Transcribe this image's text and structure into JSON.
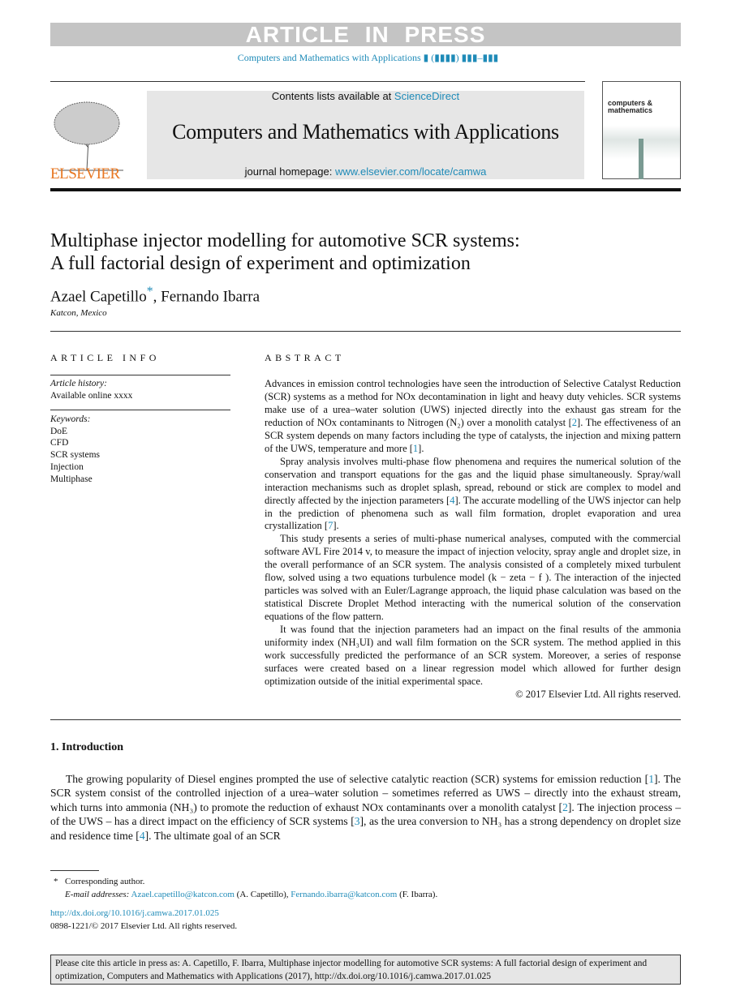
{
  "banner": "ARTICLE IN PRESS",
  "journal_ref": "Computers and Mathematics with Applications ▮ (▮▮▮▮) ▮▮▮–▮▮▮",
  "publisher": "ELSEVIER",
  "contents_prefix": "Contents lists available at ",
  "contents_link": "ScienceDirect",
  "journal_title": "Computers and Mathematics with Applications",
  "homepage_prefix": "journal homepage: ",
  "homepage_link": "www.elsevier.com/locate/camwa",
  "cover_title": "computers & mathematics",
  "title_line1": "Multiphase injector modelling for automotive SCR systems:",
  "title_line2": "A full factorial design of experiment and optimization",
  "author1": "Azael Capetillo",
  "author_star": "*",
  "author_sep": ", ",
  "author2": "Fernando Ibarra",
  "affiliation": "Katcon, Mexico",
  "article_info": {
    "heading": "ARTICLE INFO",
    "history_label": "Article history:",
    "history_value": "Available online xxxx",
    "keywords_label": "Keywords:",
    "keywords": [
      "DoE",
      "CFD",
      "SCR systems",
      "Injection",
      "Multiphase"
    ]
  },
  "abstract": {
    "heading": "ABSTRACT",
    "paragraphs": [
      [
        {
          "t": "Advances in emission control technologies have seen the introduction of Selective Catalyst Reduction (SCR) systems as a method for NOx decontamination in light and heavy duty vehicles. SCR systems make use of a urea–water solution (UWS) injected directly into the exhaust gas stream for the reduction of NOx contaminants to Nitrogen (N₂) over a monolith catalyst ["
        },
        {
          "t": "2",
          "l": 1
        },
        {
          "t": "]. The effectiveness of an SCR system depends on many factors including the type of catalysts, the injection and mixing pattern of the UWS, temperature and more ["
        },
        {
          "t": "1",
          "l": 1
        },
        {
          "t": "]."
        }
      ],
      [
        {
          "t": "Spray analysis involves multi-phase flow phenomena and requires the numerical solution of the conservation and transport equations for the gas and the liquid phase simultaneously. Spray/wall interaction mechanisms such as droplet splash, spread, rebound or stick are complex to model and directly affected by the injection parameters ["
        },
        {
          "t": "4",
          "l": 1
        },
        {
          "t": "]. The accurate modelling of the UWS injector can help in the prediction of phenomena such as wall film formation, droplet evaporation and urea crystallization ["
        },
        {
          "t": "7",
          "l": 1
        },
        {
          "t": "]."
        }
      ],
      [
        {
          "t": "This study presents a series of multi-phase numerical analyses, computed with the commercial software AVL Fire 2014 v, to measure the impact of injection velocity, spray angle and droplet size, in the overall performance of an SCR system. The analysis consisted of a completely mixed turbulent flow, solved using a two equations turbulence model (k − zeta − f ). The interaction of the injected particles was solved with an Euler/Lagrange approach, the liquid phase calculation was based on the statistical Discrete Droplet Method interacting with the numerical solution of the conservation equations of the flow pattern."
        }
      ],
      [
        {
          "t": "It was found that the injection parameters had an impact on the final results of the ammonia uniformity index (NH₃UI) and wall film formation on the SCR system. The method applied in this work successfully predicted the performance of an SCR system. Moreover, a series of response surfaces were created based on a linear regression model which allowed for further design optimization outside of the initial experimental space."
        }
      ]
    ],
    "copyright": "© 2017 Elsevier Ltd. All rights reserved."
  },
  "intro": {
    "heading": "1.  Introduction",
    "paragraph": [
      {
        "t": "The growing popularity of Diesel engines prompted the use of selective catalytic reaction (SCR) systems for emission reduction ["
      },
      {
        "t": "1",
        "l": 1
      },
      {
        "t": "]. The SCR system consist of the controlled injection of a urea–water solution – sometimes referred as UWS – directly into the exhaust stream, which turns into ammonia (NH₃) to promote the reduction of exhaust NOx contaminants over a monolith catalyst ["
      },
      {
        "t": "2",
        "l": 1
      },
      {
        "t": "]. The injection process – of the UWS – has a direct impact on the efficiency of SCR systems ["
      },
      {
        "t": "3",
        "l": 1
      },
      {
        "t": "], as the urea conversion to NH₃ has a strong dependency on droplet size and residence time ["
      },
      {
        "t": "4",
        "l": 1
      },
      {
        "t": "]. The ultimate goal of an SCR"
      }
    ]
  },
  "footnote": {
    "star": "*",
    "corresponding": "Corresponding author.",
    "email_label": "E-mail addresses:",
    "email1": "Azael.capetillo@katcon.com",
    "email1_name": " (A. Capetillo), ",
    "email2": "Fernando.ibarra@katcon.com",
    "email2_name": " (F. Ibarra)."
  },
  "doi": "http://dx.doi.org/10.1016/j.camwa.2017.01.025",
  "issn": "0898-1221/© 2017 Elsevier Ltd. All rights reserved.",
  "cite": "Please cite this article in press as: A. Capetillo, F. Ibarra, Multiphase injector modelling for automotive SCR systems: A full factorial design of experiment and optimization, Computers and Mathematics with Applications (2017), http://dx.doi.org/10.1016/j.camwa.2017.01.025"
}
